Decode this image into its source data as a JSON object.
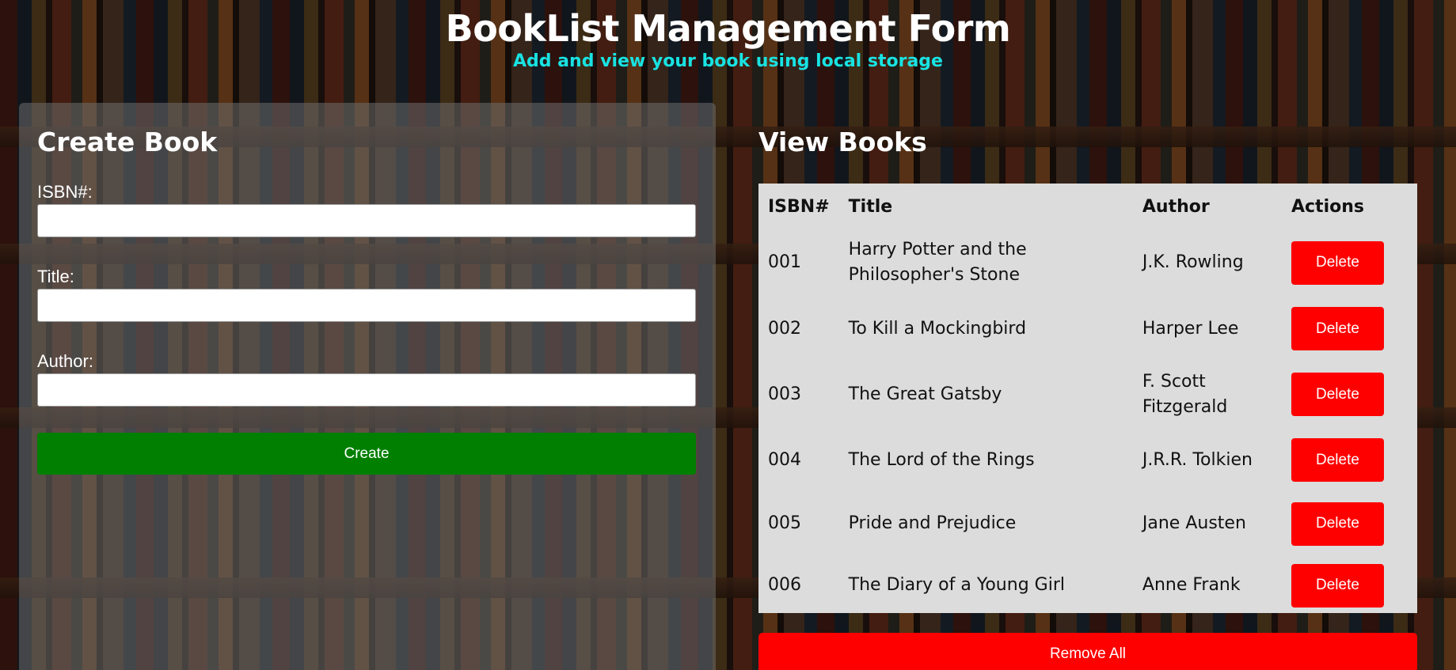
{
  "header": {
    "title": "BookList Management Form",
    "subtitle": "Add and view your book using local storage"
  },
  "create_panel": {
    "heading": "Create Book",
    "fields": [
      {
        "label": "ISBN#:",
        "value": ""
      },
      {
        "label": "Title:",
        "value": ""
      },
      {
        "label": "Author:",
        "value": ""
      }
    ],
    "create_label": "Create"
  },
  "view_panel": {
    "heading": "View Books",
    "columns": [
      "ISBN#",
      "Title",
      "Author",
      "Actions"
    ],
    "rows": [
      {
        "isbn": "001",
        "title": "Harry Potter and the Philosopher's Stone",
        "author": "J.K. Rowling",
        "action": "Delete"
      },
      {
        "isbn": "002",
        "title": "To Kill a Mockingbird",
        "author": "Harper Lee",
        "action": "Delete"
      },
      {
        "isbn": "003",
        "title": "The Great Gatsby",
        "author": "F. Scott Fitzgerald",
        "action": "Delete"
      },
      {
        "isbn": "004",
        "title": "The Lord of the Rings",
        "author": "J.R.R. Tolkien",
        "action": "Delete"
      },
      {
        "isbn": "005",
        "title": "Pride and Prejudice",
        "author": "Jane Austen",
        "action": "Delete"
      },
      {
        "isbn": "006",
        "title": "The Diary of a Young Girl",
        "author": "Anne Frank",
        "action": "Delete"
      }
    ],
    "remove_all_label": "Remove All"
  },
  "colors": {
    "title": "#ffffff",
    "subtitle": "#19e2e2",
    "create_button": "#007f00",
    "delete_button": "#ff0000",
    "remove_all_button": "#ff0000",
    "table_background": "#dcdcdc"
  }
}
